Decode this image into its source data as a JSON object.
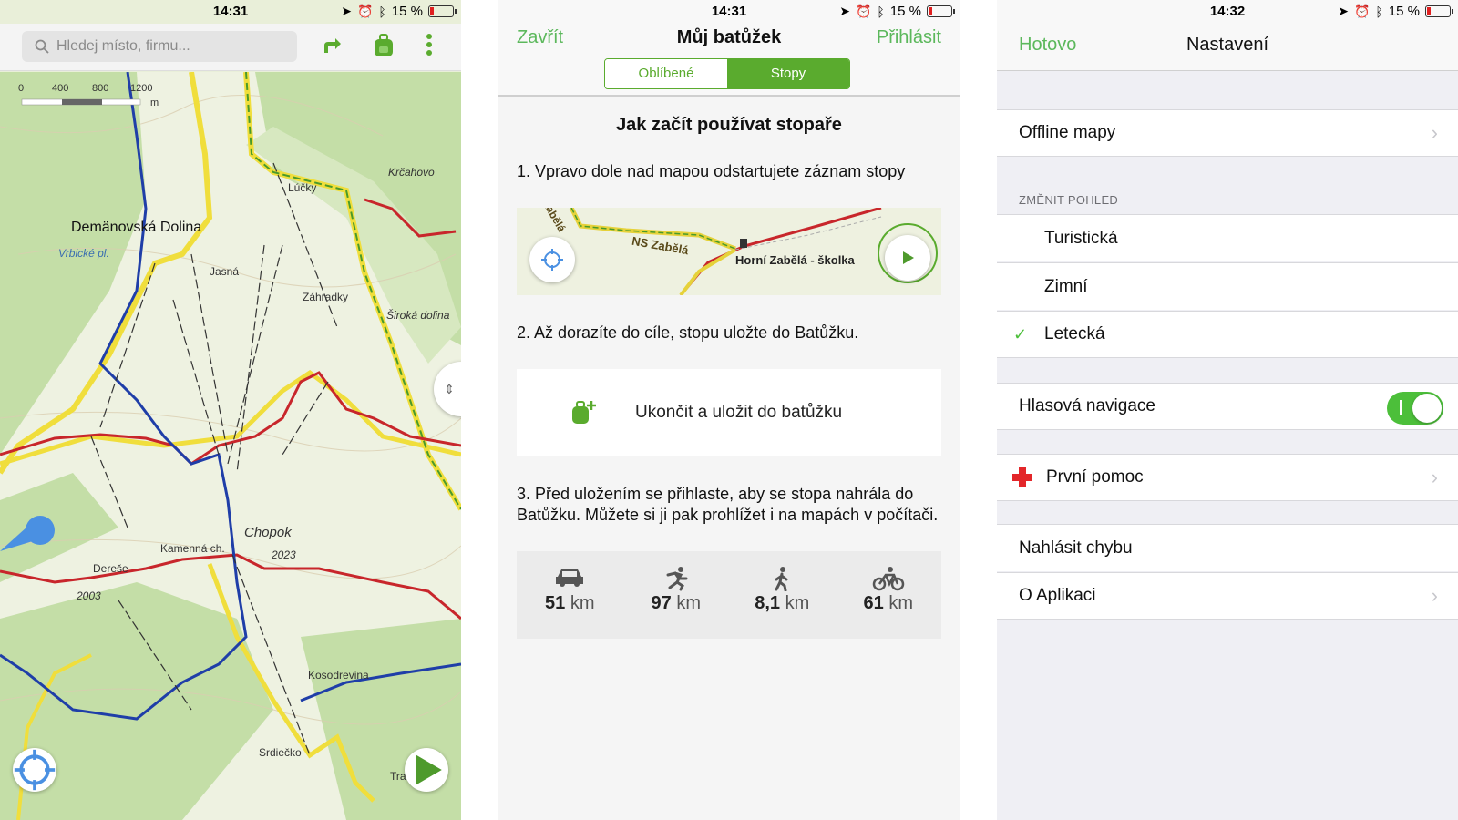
{
  "screen1": {
    "status": {
      "time": "14:31",
      "battery": "15 %"
    },
    "search": {
      "placeholder": "Hledej místo, firmu..."
    },
    "icons": {
      "search": "search-icon",
      "route": "route-arrow-icon",
      "backpack": "backpack-icon",
      "more": "more-vertical-icon",
      "locate": "locate-icon",
      "play": "play-icon"
    },
    "scale": {
      "ticks": [
        "0",
        "400",
        "800",
        "1200"
      ],
      "unit": "m"
    },
    "labels": {
      "demanovska": "Demänovská Dolina",
      "vrbicke": "Vrbické pl.",
      "lucky": "Lúčky",
      "krcahovo": "Krčahovo",
      "jasna": "Jasná",
      "zahradky": "Záhradky",
      "siroka": "Široká dolina",
      "chopok": "Chopok",
      "chopok_alt": "2023",
      "kamenna": "Kamenná ch.",
      "derese": "Dereše",
      "derese_alt": "2003",
      "kosodrevina": "Kosodrevina",
      "srdiecko": "Srdiečko",
      "tra": "Tra"
    },
    "colors": {
      "map_bg": "#e9efd9",
      "forest": "#bfdca1",
      "red_trail": "#c8262b",
      "blue_trail": "#1f3ea8",
      "yellow_road": "#f0de3c",
      "accent": "#5aab2e"
    }
  },
  "screen2": {
    "status": {
      "time": "14:31",
      "battery": "15 %"
    },
    "nav": {
      "close": "Zavřít",
      "title": "Můj batůžek",
      "login": "Přihlásit"
    },
    "tabs": [
      {
        "label": "Oblíbené",
        "selected": false
      },
      {
        "label": "Stopy",
        "selected": true
      }
    ],
    "heading": "Jak začít používat stopaře",
    "step1": "1. Vpravo dole nad mapou odstartujete záznam stopy",
    "step1_map": {
      "label_a": "NS Zabělá",
      "label_b": "Horní Zabělá - školka",
      "label_c": "Zabělá"
    },
    "step2": "2. Až dorazíte do cíle, stopu uložte do Batůžku.",
    "save_label": "Ukončit a uložit do batůžku",
    "step3": "3. Před uložením se přihlaste, aby se stopa nahrála do Batůžku. Můžete si ji pak prohlížet i na mapách v počítači.",
    "stats": [
      {
        "icon": "car-icon",
        "value": "51",
        "unit": "km"
      },
      {
        "icon": "run-icon",
        "value": "97",
        "unit": "km"
      },
      {
        "icon": "walk-icon",
        "value": "8,1",
        "unit": "km"
      },
      {
        "icon": "bike-icon",
        "value": "61",
        "unit": "km"
      }
    ]
  },
  "screen3": {
    "status": {
      "time": "14:32",
      "battery": "15 %"
    },
    "nav": {
      "done": "Hotovo",
      "title": "Nastavení"
    },
    "offline": "Offline mapy",
    "section_header": "ZMĚNIT POHLED",
    "views": [
      {
        "label": "Turistická",
        "checked": false
      },
      {
        "label": "Zimní",
        "checked": false
      },
      {
        "label": "Letecká",
        "checked": true
      }
    ],
    "voice_nav": {
      "label": "Hlasová navigace",
      "on": true
    },
    "first_aid": "První pomoc",
    "report": "Nahlásit chybu",
    "about": "O Aplikaci"
  }
}
